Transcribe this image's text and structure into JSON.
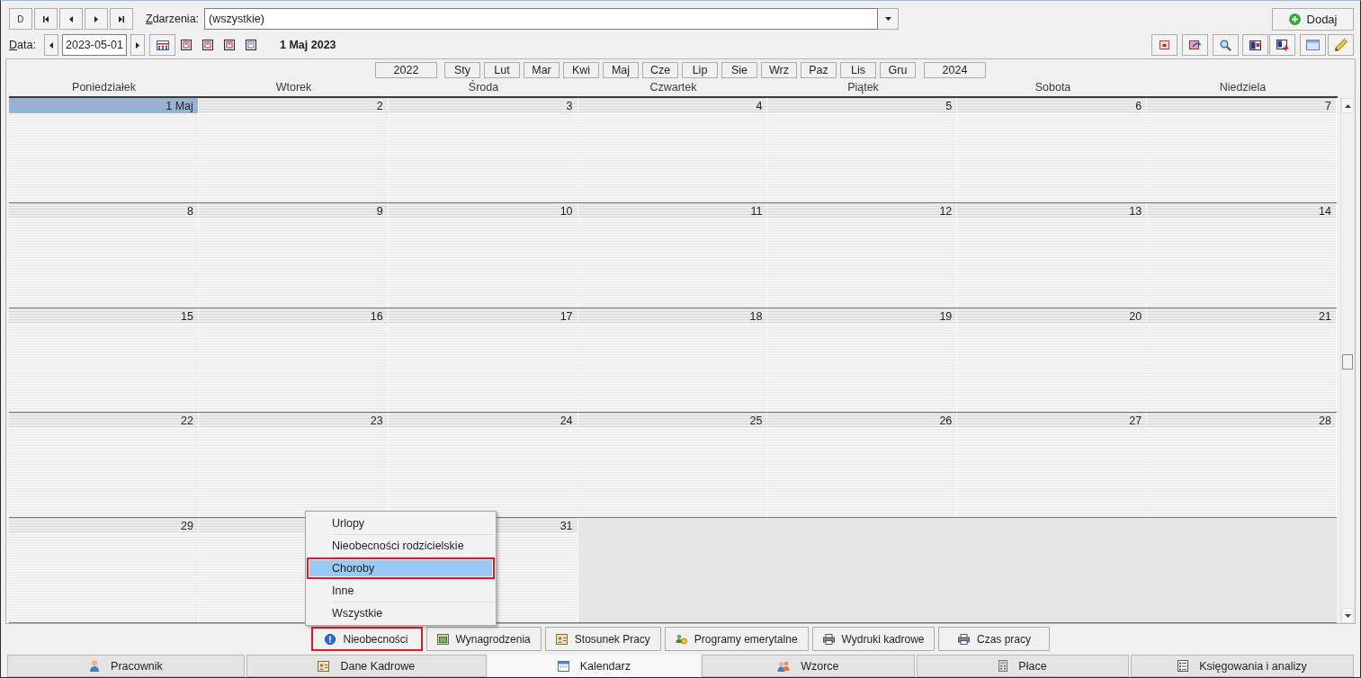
{
  "events_filter": {
    "label": "Zdarzenia:",
    "value": "(wszystkie)"
  },
  "add_button": {
    "label": "Dodaj"
  },
  "date_field": {
    "label": "Data:",
    "value": "2023-05-01"
  },
  "current_date": "1 Maj 2023",
  "year_nav": {
    "previous": "2022",
    "next": "2024"
  },
  "months": [
    "Sty",
    "Lut",
    "Mar",
    "Kwi",
    "Maj",
    "Cze",
    "Lip",
    "Sie",
    "Wrz",
    "Paz",
    "Lis",
    "Gru"
  ],
  "weekdays": [
    "Poniedziałek",
    "Wtorek",
    "Środa",
    "Czwartek",
    "Piątek",
    "Sobota",
    "Niedziela"
  ],
  "weeks": [
    {
      "days": [
        {
          "label": "1 Maj",
          "selected": true
        },
        {
          "label": "2",
          "selected": false
        },
        {
          "label": "3",
          "selected": false
        },
        {
          "label": "4",
          "selected": false
        },
        {
          "label": "5",
          "selected": false
        },
        {
          "label": "6",
          "selected": false
        },
        {
          "label": "7",
          "selected": false
        }
      ]
    },
    {
      "days": [
        {
          "label": "8",
          "selected": false
        },
        {
          "label": "9",
          "selected": false
        },
        {
          "label": "10",
          "selected": false
        },
        {
          "label": "11",
          "selected": false
        },
        {
          "label": "12",
          "selected": false
        },
        {
          "label": "13",
          "selected": false
        },
        {
          "label": "14",
          "selected": false
        }
      ]
    },
    {
      "days": [
        {
          "label": "15",
          "selected": false
        },
        {
          "label": "16",
          "selected": false
        },
        {
          "label": "17",
          "selected": false
        },
        {
          "label": "18",
          "selected": false
        },
        {
          "label": "19",
          "selected": false
        },
        {
          "label": "20",
          "selected": false
        },
        {
          "label": "21",
          "selected": false
        }
      ]
    },
    {
      "days": [
        {
          "label": "22",
          "selected": false
        },
        {
          "label": "23",
          "selected": false
        },
        {
          "label": "24",
          "selected": false
        },
        {
          "label": "25",
          "selected": false
        },
        {
          "label": "26",
          "selected": false
        },
        {
          "label": "27",
          "selected": false
        },
        {
          "label": "28",
          "selected": false
        }
      ]
    },
    {
      "days": [
        {
          "label": "29",
          "selected": false
        },
        {
          "selected": false
        },
        {
          "label": "31",
          "selected": false
        }
      ]
    }
  ],
  "context_menu": {
    "items": [
      {
        "label": "Urlopy",
        "selected": false,
        "highlighted": false
      },
      {
        "label": "Nieobecności rodzicielskie",
        "selected": false,
        "highlighted": false
      },
      {
        "label": "Choroby",
        "selected": true,
        "highlighted": true
      },
      {
        "label": "Inne",
        "selected": false,
        "highlighted": false
      },
      {
        "label": "Wszystkie",
        "selected": false,
        "highlighted": false
      }
    ]
  },
  "sub_tabs": [
    {
      "label": "Nieobecności",
      "highlighted": true
    },
    {
      "label": "Wynagrodzenia",
      "highlighted": false
    },
    {
      "label": "Stosunek Pracy",
      "highlighted": false
    },
    {
      "label": "Programy emerytalne",
      "highlighted": false
    },
    {
      "label": "Wydruki kadrowe",
      "highlighted": false
    },
    {
      "label": "Czas pracy",
      "highlighted": false
    }
  ],
  "main_tabs": [
    {
      "label": "Pracownik",
      "selected": false
    },
    {
      "label": "Dane Kadrowe",
      "selected": false
    },
    {
      "label": "Kalendarz",
      "selected": true
    },
    {
      "label": "Wzorce",
      "selected": false
    },
    {
      "label": "Płace",
      "selected": false
    },
    {
      "label": "Księgowania i analizy",
      "selected": false
    }
  ]
}
